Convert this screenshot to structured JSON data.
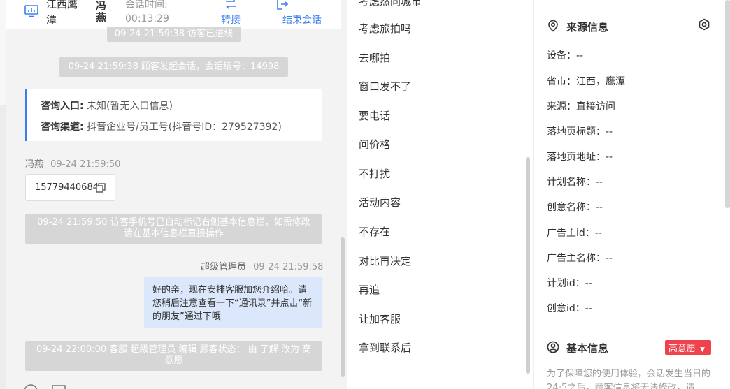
{
  "header": {
    "location_line1": "江西鹰",
    "location_line2": "潭",
    "visitor_name": "冯燕",
    "time_label": "会话时间:",
    "time_value": "00:13:29",
    "transfer_label": "转接",
    "end_label": "结束会话"
  },
  "chat": {
    "sys_visitor_entered": "09-24 21:59:38 访客已进线",
    "sys_session_start": "09-24 21:59:38 顾客发起会话，会话编号：14998",
    "entry": {
      "entry_label": "咨询入口:",
      "entry_value": "未知(暂无入口信息)",
      "channel_label": "咨询渠道:",
      "channel_value": "抖音企业号/员工号(抖音号ID：279527392)"
    },
    "visitor_msg": {
      "sender": "冯燕",
      "time": "09-24 21:59:50",
      "phone": "15779440684"
    },
    "sys_phone_marked": "09-24 21:59:50 访客手机号已自动标记右侧基本信息栏，如需修改请在基本信息栏直接操作",
    "agent_msg": {
      "sender": "超级管理员",
      "time": "09-24 21:59:58",
      "text": "好的亲，现在安排客服加您介绍哈。请您稍后注意查看一下“通讯录”并点击“新的朋友”通过下哦"
    },
    "sys_status_change": "09-24 22:00:00 客服 超级管理员 编辑 顾客状态： 由 了解 改为 高意愿"
  },
  "quick_replies": {
    "partial_top": "考虑然同城市",
    "items": [
      "考虑旅拍吗",
      "去哪拍",
      "窗口发不了",
      "要电话",
      "问价格",
      "不打扰",
      "活动内容",
      "不存在",
      "对比再决定",
      "再追",
      "让加客服",
      "拿到联系后"
    ]
  },
  "source_info": {
    "title": "来源信息",
    "rows": [
      {
        "label": "设备：",
        "value": "--"
      },
      {
        "label": "省市：",
        "value": "江西，鹰潭"
      },
      {
        "label": "来源：",
        "value": "直接访问"
      },
      {
        "label": "落地页标题：",
        "value": "--"
      },
      {
        "label": "落地页地址：",
        "value": "--"
      },
      {
        "label": "计划名称：",
        "value": "--"
      },
      {
        "label": "创意名称：",
        "value": "--"
      },
      {
        "label": "广告主id：",
        "value": "--"
      },
      {
        "label": "广告主名称：",
        "value": "--"
      },
      {
        "label": "计划id：",
        "value": "--"
      },
      {
        "label": "创意id：",
        "value": "--"
      }
    ]
  },
  "basic_info": {
    "title": "基本信息",
    "intent_badge": "高意愿",
    "notice": "为了保障您的使用体验，会话发生当日的24点之后，顾客信息将无法修改，请"
  },
  "colors": {
    "accent": "#3a7ef0",
    "badge_red": "#f0424d",
    "agent_bubble": "#dbe8fb",
    "system_pill": "#d6d6d6"
  }
}
